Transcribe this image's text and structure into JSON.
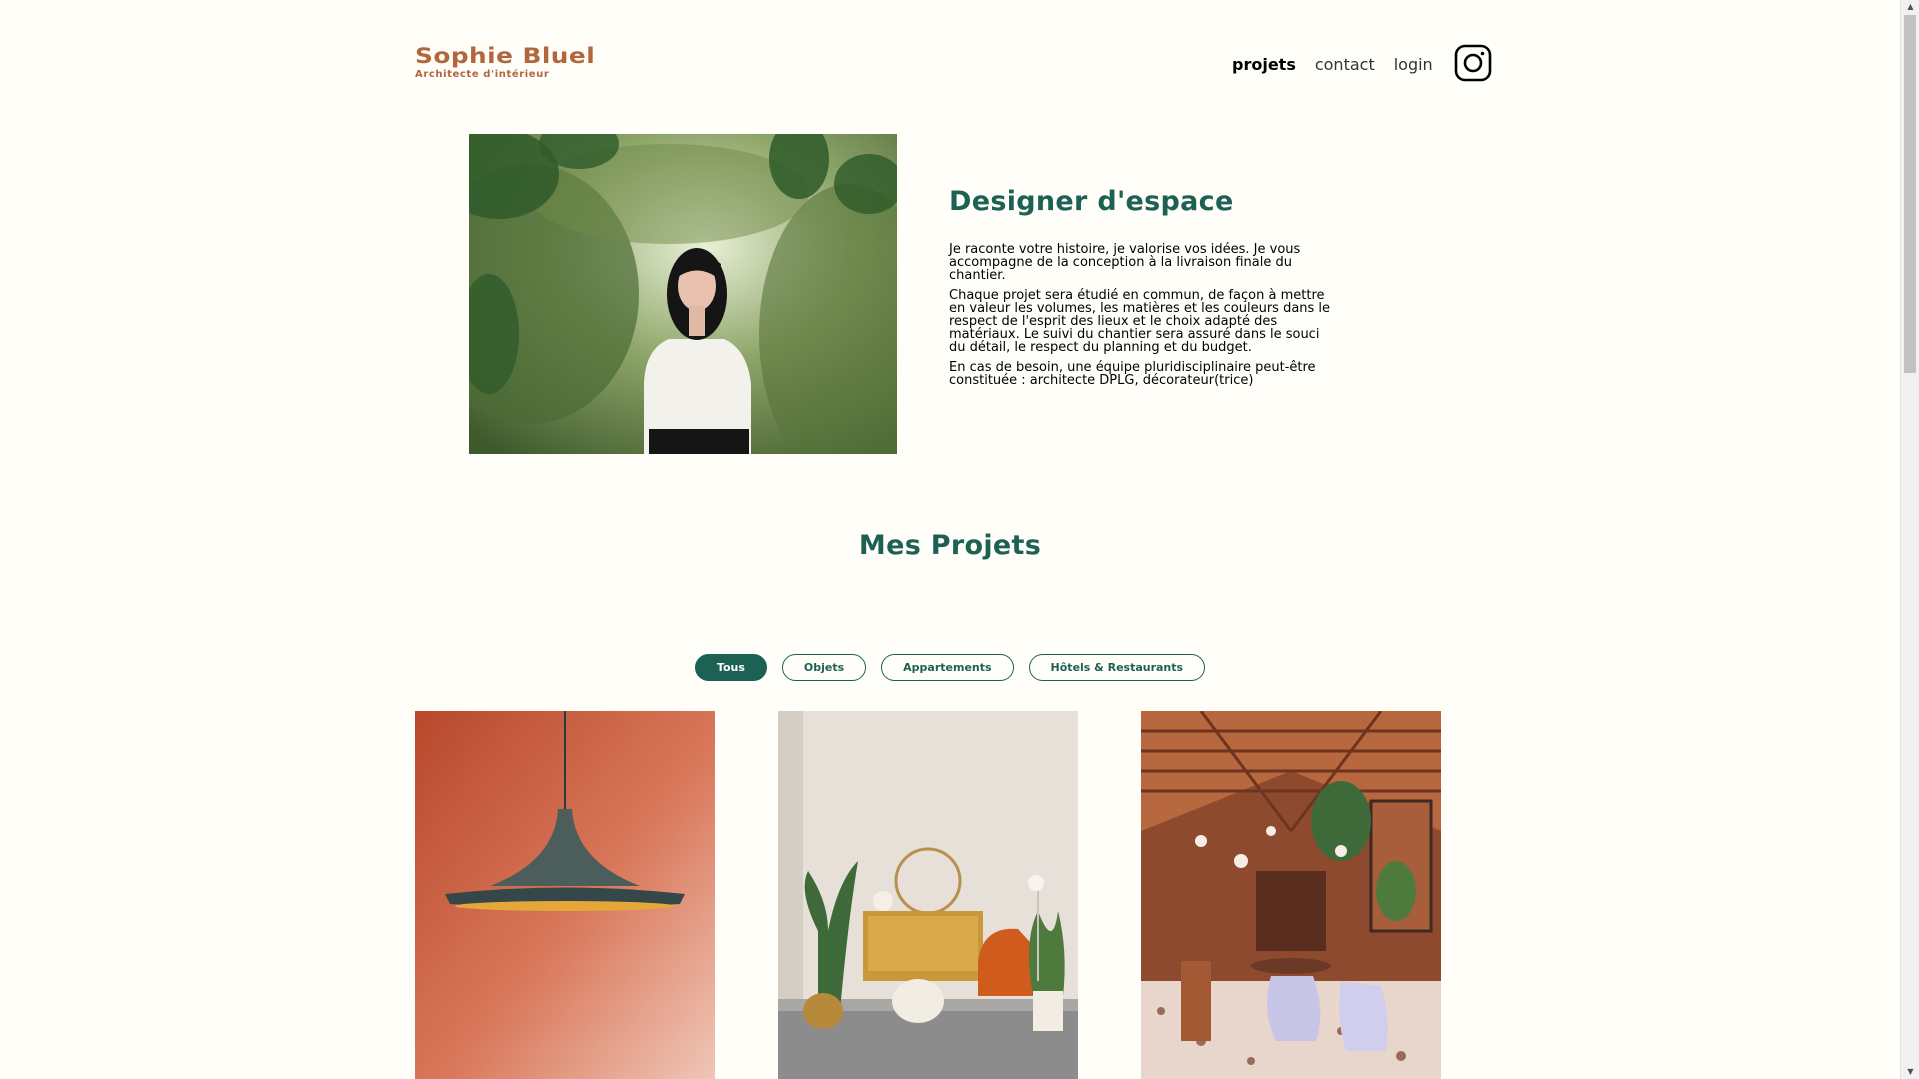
{
  "header": {
    "logo_title": "Sophie Bluel",
    "logo_subtitle": "Architecte d'intérieur",
    "nav": [
      {
        "label": "projets",
        "active": true
      },
      {
        "label": "contact",
        "active": false
      },
      {
        "label": "login",
        "active": false
      }
    ],
    "instagram_icon": "instagram-icon"
  },
  "introduction": {
    "title": "Designer d'espace",
    "paragraphs": [
      "Je raconte votre histoire, je valorise vos idées. Je vous accompagne de la conception à la livraison finale du chantier.",
      "Chaque projet sera étudié en commun, de façon à mettre en valeur les volumes, les matières et les couleurs dans le respect de l'esprit des lieux et le choix adapté des matériaux. Le suivi du chantier sera assuré dans le souci du détail, le respect du planning et du budget.",
      "En cas de besoin, une équipe pluridisciplinaire peut-être constituée : architecte DPLG, décorateur(trice)"
    ]
  },
  "projects": {
    "title": "Mes Projets",
    "filters": [
      {
        "label": "Tous",
        "active": true
      },
      {
        "label": "Objets",
        "active": false
      },
      {
        "label": "Appartements",
        "active": false
      },
      {
        "label": "Hôtels & Restaurants",
        "active": false
      }
    ]
  },
  "colors": {
    "accent": "#1D6154",
    "brand": "#B1663C",
    "background": "#FFFEF8"
  }
}
